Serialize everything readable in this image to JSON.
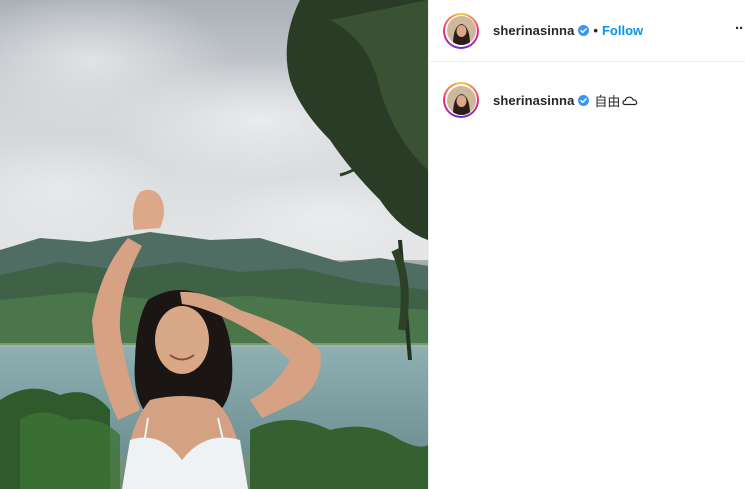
{
  "post": {
    "author": {
      "username": "sherinasinna",
      "verified": true,
      "follow_label": "Follow",
      "separator": "•"
    },
    "more_options_label": "··",
    "caption": {
      "username": "sherinasinna",
      "verified": true,
      "text": "自由"
    },
    "icons": {
      "verified": "verified-badge-icon",
      "more": "more-options-icon",
      "caption_emoji": "cloud-icon"
    },
    "colors": {
      "follow": "#0095f6",
      "verified": "#3897f0",
      "divider": "#efefef"
    }
  }
}
